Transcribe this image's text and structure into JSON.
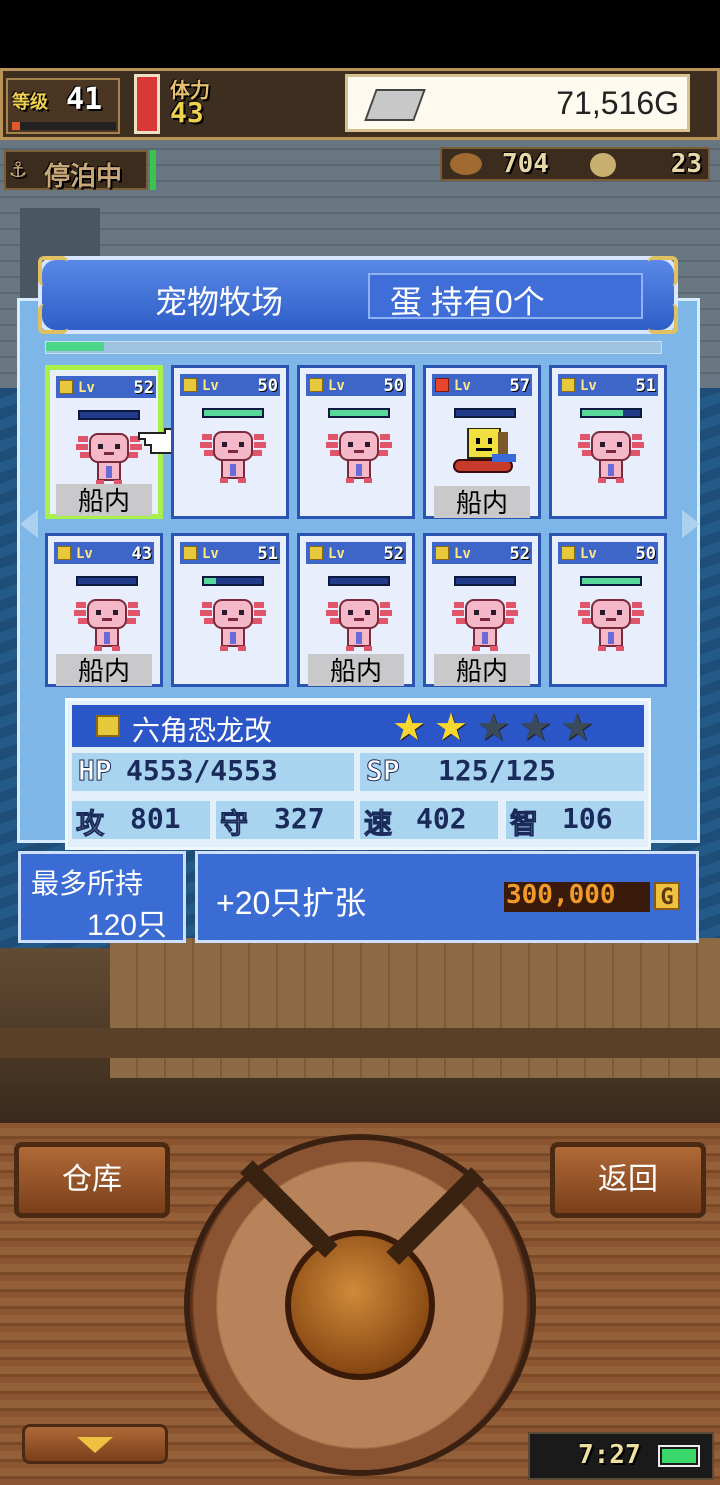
{
  "hud": {
    "level_label": "等级",
    "level": "41",
    "stamina_label": "体力",
    "stamina": "43",
    "gold": "71,516G",
    "status": "停泊中",
    "resource1": "704",
    "resource2": "23"
  },
  "panel": {
    "title": "宠物牧场",
    "eggs": "蛋 持有0个"
  },
  "cards": [
    {
      "lv": "Lv",
      "level": "52",
      "icon": "electric-element-icon",
      "sprite": "axolotl",
      "hp_fill": 0.0,
      "on_ship": true,
      "ship_label": "船内",
      "selected": true
    },
    {
      "lv": "Lv",
      "level": "50",
      "icon": "electric-element-icon",
      "sprite": "axolotl",
      "hp_fill": 1.0,
      "on_ship": false,
      "ship_label": ""
    },
    {
      "lv": "Lv",
      "level": "50",
      "icon": "electric-element-icon",
      "sprite": "axolotl",
      "hp_fill": 1.0,
      "on_ship": false,
      "ship_label": ""
    },
    {
      "lv": "Lv",
      "level": "57",
      "icon": "fire-element-icon",
      "sprite": "yellow-block",
      "hp_fill": 0.0,
      "on_ship": true,
      "ship_label": "船内"
    },
    {
      "lv": "Lv",
      "level": "51",
      "icon": "electric-element-icon",
      "sprite": "axolotl",
      "hp_fill": 0.7,
      "on_ship": false,
      "ship_label": ""
    },
    {
      "lv": "Lv",
      "level": "43",
      "icon": "electric-element-icon",
      "sprite": "axolotl",
      "hp_fill": 0.0,
      "on_ship": true,
      "ship_label": "船内"
    },
    {
      "lv": "Lv",
      "level": "51",
      "icon": "electric-element-icon",
      "sprite": "axolotl",
      "hp_fill": 0.2,
      "on_ship": false,
      "ship_label": ""
    },
    {
      "lv": "Lv",
      "level": "52",
      "icon": "electric-element-icon",
      "sprite": "axolotl",
      "hp_fill": 0.0,
      "on_ship": true,
      "ship_label": "船内"
    },
    {
      "lv": "Lv",
      "level": "52",
      "icon": "electric-element-icon",
      "sprite": "axolotl",
      "hp_fill": 0.0,
      "on_ship": true,
      "ship_label": "船内"
    },
    {
      "lv": "Lv",
      "level": "50",
      "icon": "electric-element-icon",
      "sprite": "axolotl",
      "hp_fill": 1.0,
      "on_ship": false,
      "ship_label": ""
    }
  ],
  "selected_pet": {
    "name": "六角恐龙改",
    "stars": 2,
    "max_stars": 5,
    "hp_label": "HP",
    "hp": "4553/4553",
    "sp_label": "SP",
    "sp": "125/125",
    "atk_label": "攻",
    "atk": "801",
    "def_label": "守",
    "def": "327",
    "spd_label": "速",
    "spd": "402",
    "int_label": "智",
    "int": "106"
  },
  "capacity": {
    "label": "最多所持",
    "value": "120只"
  },
  "expand": {
    "label": "+20只扩张",
    "price": "300,000",
    "currency": "G"
  },
  "controls": {
    "warehouse": "仓库",
    "back": "返回",
    "time": "7:27"
  },
  "colors": {
    "panel_bg": "#7fb6e8",
    "title_bg": "#2e5ec8",
    "select_border": "#a8f04a",
    "hp_bar": "#5ad89c"
  }
}
